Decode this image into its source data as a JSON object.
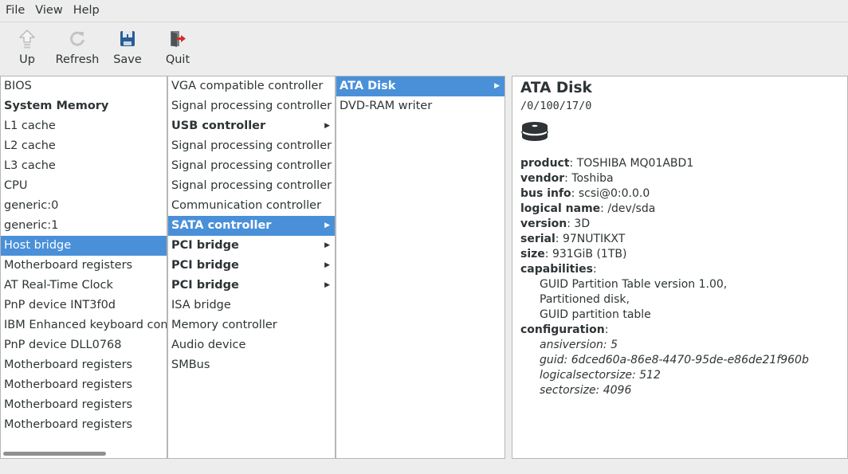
{
  "menubar": {
    "file": "File",
    "view": "View",
    "help": "Help"
  },
  "toolbar": {
    "up": "Up",
    "refresh": "Refresh",
    "save": "Save",
    "quit": "Quit"
  },
  "column1": [
    {
      "label": "BIOS",
      "bold": false,
      "selected": false
    },
    {
      "label": "System Memory",
      "bold": true,
      "selected": false
    },
    {
      "label": "L1 cache",
      "bold": false,
      "selected": false
    },
    {
      "label": "L2 cache",
      "bold": false,
      "selected": false
    },
    {
      "label": "L3 cache",
      "bold": false,
      "selected": false
    },
    {
      "label": "CPU",
      "bold": false,
      "selected": false
    },
    {
      "label": "generic:0",
      "bold": false,
      "selected": false
    },
    {
      "label": "generic:1",
      "bold": false,
      "selected": false
    },
    {
      "label": "Host bridge",
      "bold": false,
      "selected": true
    },
    {
      "label": "Motherboard registers",
      "bold": false,
      "selected": false
    },
    {
      "label": "AT Real-Time Clock",
      "bold": false,
      "selected": false
    },
    {
      "label": "PnP device INT3f0d",
      "bold": false,
      "selected": false
    },
    {
      "label": "IBM Enhanced keyboard controller",
      "bold": false,
      "selected": false
    },
    {
      "label": "PnP device DLL0768",
      "bold": false,
      "selected": false
    },
    {
      "label": "Motherboard registers",
      "bold": false,
      "selected": false
    },
    {
      "label": "Motherboard registers",
      "bold": false,
      "selected": false
    },
    {
      "label": "Motherboard registers",
      "bold": false,
      "selected": false
    },
    {
      "label": "Motherboard registers",
      "bold": false,
      "selected": false
    }
  ],
  "column2": [
    {
      "label": "VGA compatible controller",
      "bold": false,
      "selected": false,
      "arrow": false
    },
    {
      "label": "Signal processing controller",
      "bold": false,
      "selected": false,
      "arrow": false
    },
    {
      "label": "USB controller",
      "bold": true,
      "selected": false,
      "arrow": true
    },
    {
      "label": "Signal processing controller",
      "bold": false,
      "selected": false,
      "arrow": false
    },
    {
      "label": "Signal processing controller",
      "bold": false,
      "selected": false,
      "arrow": false
    },
    {
      "label": "Signal processing controller",
      "bold": false,
      "selected": false,
      "arrow": false
    },
    {
      "label": "Communication controller",
      "bold": false,
      "selected": false,
      "arrow": false
    },
    {
      "label": "SATA controller",
      "bold": true,
      "selected": true,
      "arrow": true
    },
    {
      "label": "PCI bridge",
      "bold": true,
      "selected": false,
      "arrow": true
    },
    {
      "label": "PCI bridge",
      "bold": true,
      "selected": false,
      "arrow": true
    },
    {
      "label": "PCI bridge",
      "bold": true,
      "selected": false,
      "arrow": true
    },
    {
      "label": "ISA bridge",
      "bold": false,
      "selected": false,
      "arrow": false
    },
    {
      "label": "Memory controller",
      "bold": false,
      "selected": false,
      "arrow": false
    },
    {
      "label": "Audio device",
      "bold": false,
      "selected": false,
      "arrow": false
    },
    {
      "label": "SMBus",
      "bold": false,
      "selected": false,
      "arrow": false
    }
  ],
  "column3": [
    {
      "label": "ATA Disk",
      "bold": true,
      "selected": true,
      "arrow": true
    },
    {
      "label": "DVD-RAM writer",
      "bold": false,
      "selected": false,
      "arrow": false
    }
  ],
  "arrow_glyph": "▶",
  "detail": {
    "title": "ATA Disk",
    "path": "/0/100/17/0",
    "icon": "hard-disk-icon",
    "properties": [
      {
        "key": "product",
        "value": " TOSHIBA MQ01ABD1"
      },
      {
        "key": "vendor",
        "value": " Toshiba"
      },
      {
        "key": "bus info",
        "value": " scsi@0:0.0.0"
      },
      {
        "key": "logical name",
        "value": " /dev/sda"
      },
      {
        "key": "version",
        "value": " 3D"
      },
      {
        "key": "serial",
        "value": " 97NUTIKXT"
      },
      {
        "key": "size",
        "value": " 931GiB (1TB)"
      }
    ],
    "capabilities_key": "capabilities",
    "capabilities": [
      "GUID Partition Table version 1.00,",
      "Partitioned disk,",
      "GUID partition table"
    ],
    "configuration_key": "configuration",
    "configuration": [
      "ansiversion: 5",
      "guid: 6dced60a-86e8-4470-95de-e86de21f960b",
      "logicalsectorsize: 512",
      "sectorsize: 4096"
    ]
  },
  "colors": {
    "selection": "#4a90d9",
    "window_bg": "#ededed",
    "pane_bg": "#ffffff"
  }
}
